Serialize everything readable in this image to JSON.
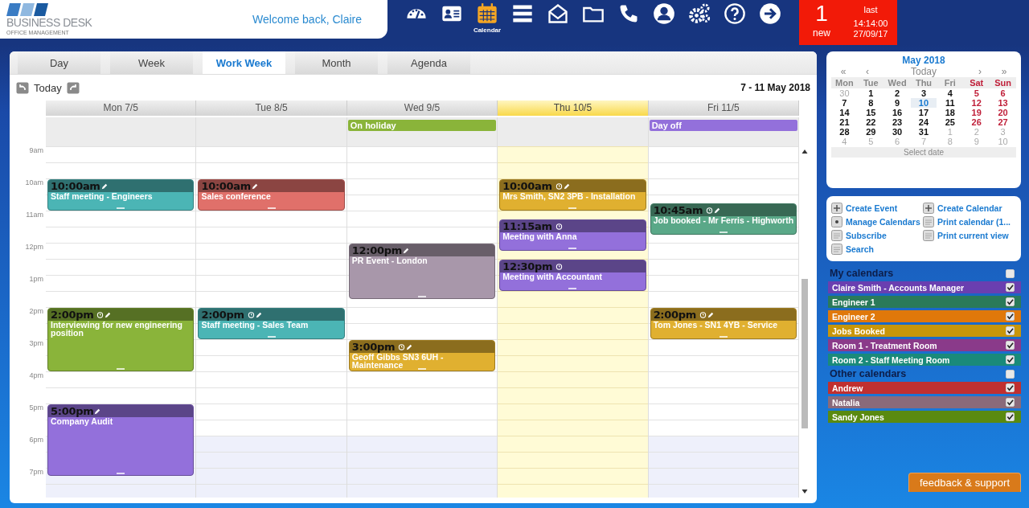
{
  "header": {
    "logo": {
      "name": "BUSINESS DESK",
      "tagline": "OFFICE MANAGEMENT"
    },
    "welcome": "Welcome back, Claire",
    "nav": [
      {
        "kind": "dashboard",
        "selected": false
      },
      {
        "kind": "contacts",
        "selected": false
      },
      {
        "kind": "calendar",
        "selected": true,
        "label": "Calendar"
      },
      {
        "kind": "list",
        "selected": false
      },
      {
        "kind": "mail",
        "selected": false
      },
      {
        "kind": "folder",
        "selected": false
      },
      {
        "kind": "phone",
        "selected": false
      },
      {
        "kind": "user",
        "selected": false
      },
      {
        "kind": "settings",
        "selected": false
      },
      {
        "kind": "help",
        "selected": false
      },
      {
        "kind": "logout",
        "selected": false
      }
    ],
    "notifications": {
      "count": "1",
      "count_label": "new",
      "last_label": "last",
      "last_time": "14:14:00",
      "last_date": "27/09/17"
    }
  },
  "calendar": {
    "tabs": [
      {
        "label": "Day",
        "selected": false
      },
      {
        "label": "Week",
        "selected": false
      },
      {
        "label": "Work Week",
        "selected": true
      },
      {
        "label": "Month",
        "selected": false
      },
      {
        "label": "Agenda",
        "selected": false
      }
    ],
    "today_button": "Today",
    "range": "7 - 11 May 2018",
    "hours": [
      "9am",
      "10am",
      "11am",
      "12pm",
      "1pm",
      "2pm",
      "3pm",
      "4pm",
      "5pm",
      "6pm",
      "7pm"
    ],
    "days": [
      {
        "label": "Mon 7/5",
        "today": false,
        "events": [
          {
            "time": "10:00am",
            "title": "Staff meeting - Engineers",
            "kind": "short",
            "color": "#4bb5b5",
            "reminder": false,
            "edit": true
          },
          {
            "time": "2:00pm",
            "title": "Interviewing for new engineering position",
            "kind": "long",
            "color": "#8ab43a",
            "reminder": true,
            "edit": true
          },
          {
            "time": "5:00pm",
            "title": "Company Audit",
            "kind": "longest",
            "color": "#9370db",
            "reminder": false,
            "edit": true
          }
        ]
      },
      {
        "label": "Tue 8/5",
        "today": false,
        "events": [
          {
            "time": "10:00am",
            "title": "Sales conference",
            "kind": "short",
            "color": "#e0706a",
            "reminder": false,
            "edit": true
          },
          {
            "time": "2:00pm",
            "title": "Staff meeting - Sales Team",
            "kind": "short",
            "color": "#4bb5b5",
            "reminder": true,
            "edit": true
          }
        ]
      },
      {
        "label": "Wed 9/5",
        "today": false,
        "all_day": [
          {
            "title": "On holiday",
            "color": "#8ab43a"
          }
        ],
        "events": [
          {
            "time": "12:00pm",
            "title": "PR Event - London",
            "kind": "medium",
            "color": "#a897aa",
            "reminder": false,
            "edit": true
          },
          {
            "time": "3:00pm",
            "title": "Geoff Gibbs SN3 6UH - Maintenance",
            "kind": "short",
            "color": "#e0b030",
            "reminder": true,
            "edit": true
          }
        ]
      },
      {
        "label": "Thu 10/5",
        "today": true,
        "events": [
          {
            "time": "10:00am",
            "title": "Mrs Smith, SN2 3PB - Installation",
            "kind": "short",
            "color": "#e0b030",
            "reminder": true,
            "edit": true
          },
          {
            "time": "11:15am",
            "title": "Meeting with Anna",
            "kind": "short",
            "color": "#9370db",
            "reminder": true,
            "edit": false
          },
          {
            "time": "12:30pm",
            "title": "Meeting with Accountant",
            "kind": "short",
            "color": "#9370db",
            "reminder": true,
            "edit": false
          }
        ]
      },
      {
        "label": "Fri 11/5",
        "today": false,
        "all_day": [
          {
            "title": "Day off",
            "color": "#9370db"
          }
        ],
        "events": [
          {
            "time": "10:45am",
            "title": "Job booked - Mr Ferris - Highworth",
            "kind": "short",
            "color": "#5aa888",
            "reminder": true,
            "edit": true
          },
          {
            "time": "2:00pm",
            "title": "Tom Jones - SN1 4YB - Service",
            "kind": "short",
            "color": "#e0b030",
            "reminder": true,
            "edit": true
          }
        ]
      }
    ]
  },
  "mini_calendar": {
    "title": "May 2018",
    "nav": [
      "«",
      "‹",
      "Today",
      "›",
      "»"
    ],
    "weekdays": [
      "Mon",
      "Tue",
      "Wed",
      "Thu",
      "Fri",
      "Sat",
      "Sun"
    ],
    "weeks": [
      [
        {
          "d": "30",
          "muted": true,
          "selected": false
        },
        {
          "d": "1",
          "muted": false,
          "selected": false
        },
        {
          "d": "2",
          "muted": false,
          "selected": false
        },
        {
          "d": "3",
          "muted": false,
          "selected": false
        },
        {
          "d": "4",
          "muted": false,
          "selected": false
        },
        {
          "d": "5",
          "muted": false,
          "selected": false
        },
        {
          "d": "6",
          "muted": false,
          "selected": false
        }
      ],
      [
        {
          "d": "7",
          "muted": false,
          "selected": false
        },
        {
          "d": "8",
          "muted": false,
          "selected": false
        },
        {
          "d": "9",
          "muted": false,
          "selected": false
        },
        {
          "d": "10",
          "muted": false,
          "selected": true
        },
        {
          "d": "11",
          "muted": false,
          "selected": false
        },
        {
          "d": "12",
          "muted": false,
          "selected": false
        },
        {
          "d": "13",
          "muted": false,
          "selected": false
        }
      ],
      [
        {
          "d": "14",
          "muted": false,
          "selected": false
        },
        {
          "d": "15",
          "muted": false,
          "selected": false
        },
        {
          "d": "16",
          "muted": false,
          "selected": false
        },
        {
          "d": "17",
          "muted": false,
          "selected": false
        },
        {
          "d": "18",
          "muted": false,
          "selected": false
        },
        {
          "d": "19",
          "muted": false,
          "selected": false
        },
        {
          "d": "20",
          "muted": false,
          "selected": false
        }
      ],
      [
        {
          "d": "21",
          "muted": false,
          "selected": false
        },
        {
          "d": "22",
          "muted": false,
          "selected": false
        },
        {
          "d": "23",
          "muted": false,
          "selected": false
        },
        {
          "d": "24",
          "muted": false,
          "selected": false
        },
        {
          "d": "25",
          "muted": false,
          "selected": false
        },
        {
          "d": "26",
          "muted": false,
          "selected": false
        },
        {
          "d": "27",
          "muted": false,
          "selected": false
        }
      ],
      [
        {
          "d": "28",
          "muted": false,
          "selected": false
        },
        {
          "d": "29",
          "muted": false,
          "selected": false
        },
        {
          "d": "30",
          "muted": false,
          "selected": false
        },
        {
          "d": "31",
          "muted": false,
          "selected": false
        },
        {
          "d": "1",
          "muted": true,
          "selected": false
        },
        {
          "d": "2",
          "muted": true,
          "selected": false
        },
        {
          "d": "3",
          "muted": true,
          "selected": false
        }
      ],
      [
        {
          "d": "4",
          "muted": true,
          "selected": false
        },
        {
          "d": "5",
          "muted": true,
          "selected": false
        },
        {
          "d": "6",
          "muted": true,
          "selected": false
        },
        {
          "d": "7",
          "muted": true,
          "selected": false
        },
        {
          "d": "8",
          "muted": true,
          "selected": false
        },
        {
          "d": "9",
          "muted": true,
          "selected": false
        },
        {
          "d": "10",
          "muted": true,
          "selected": false
        }
      ]
    ],
    "footer": "Select date"
  },
  "actions": [
    {
      "kind": "add",
      "label": "Create Event"
    },
    {
      "kind": "add",
      "label": "Create Calendar"
    },
    {
      "kind": "manage",
      "label": "Manage Calendars"
    },
    {
      "kind": "doc",
      "label": "Print calendar (1..."
    },
    {
      "kind": "doc",
      "label": "Subscribe"
    },
    {
      "kind": "doc",
      "label": "Print current view"
    },
    {
      "kind": "doc",
      "label": "Search"
    }
  ],
  "calendar_lists": [
    {
      "title": "My calendars",
      "checked": false,
      "items": [
        {
          "name": "Claire Smith - Accounts Manager",
          "color": "#6a3fb0",
          "checked": true
        },
        {
          "name": "Engineer 1",
          "color": "#2a7a5a",
          "checked": true
        },
        {
          "name": "Engineer 2",
          "color": "#e0780a",
          "checked": true
        },
        {
          "name": "Jobs Booked",
          "color": "#c8960a",
          "checked": true
        },
        {
          "name": "Room 1 - Treatment Room",
          "color": "#8a3a8a",
          "checked": true
        },
        {
          "name": "Room 2 - Staff Meeting Room",
          "color": "#1a8a7a",
          "checked": true
        }
      ]
    },
    {
      "title": "Other calendars",
      "checked": false,
      "items": [
        {
          "name": "Andrew",
          "color": "#c03030",
          "checked": true
        },
        {
          "name": "Natalia",
          "color": "#8a6a7a",
          "checked": true
        },
        {
          "name": "Sandy Jones",
          "color": "#5a8a10",
          "checked": true
        }
      ]
    }
  ],
  "feedback": "feedback & support"
}
